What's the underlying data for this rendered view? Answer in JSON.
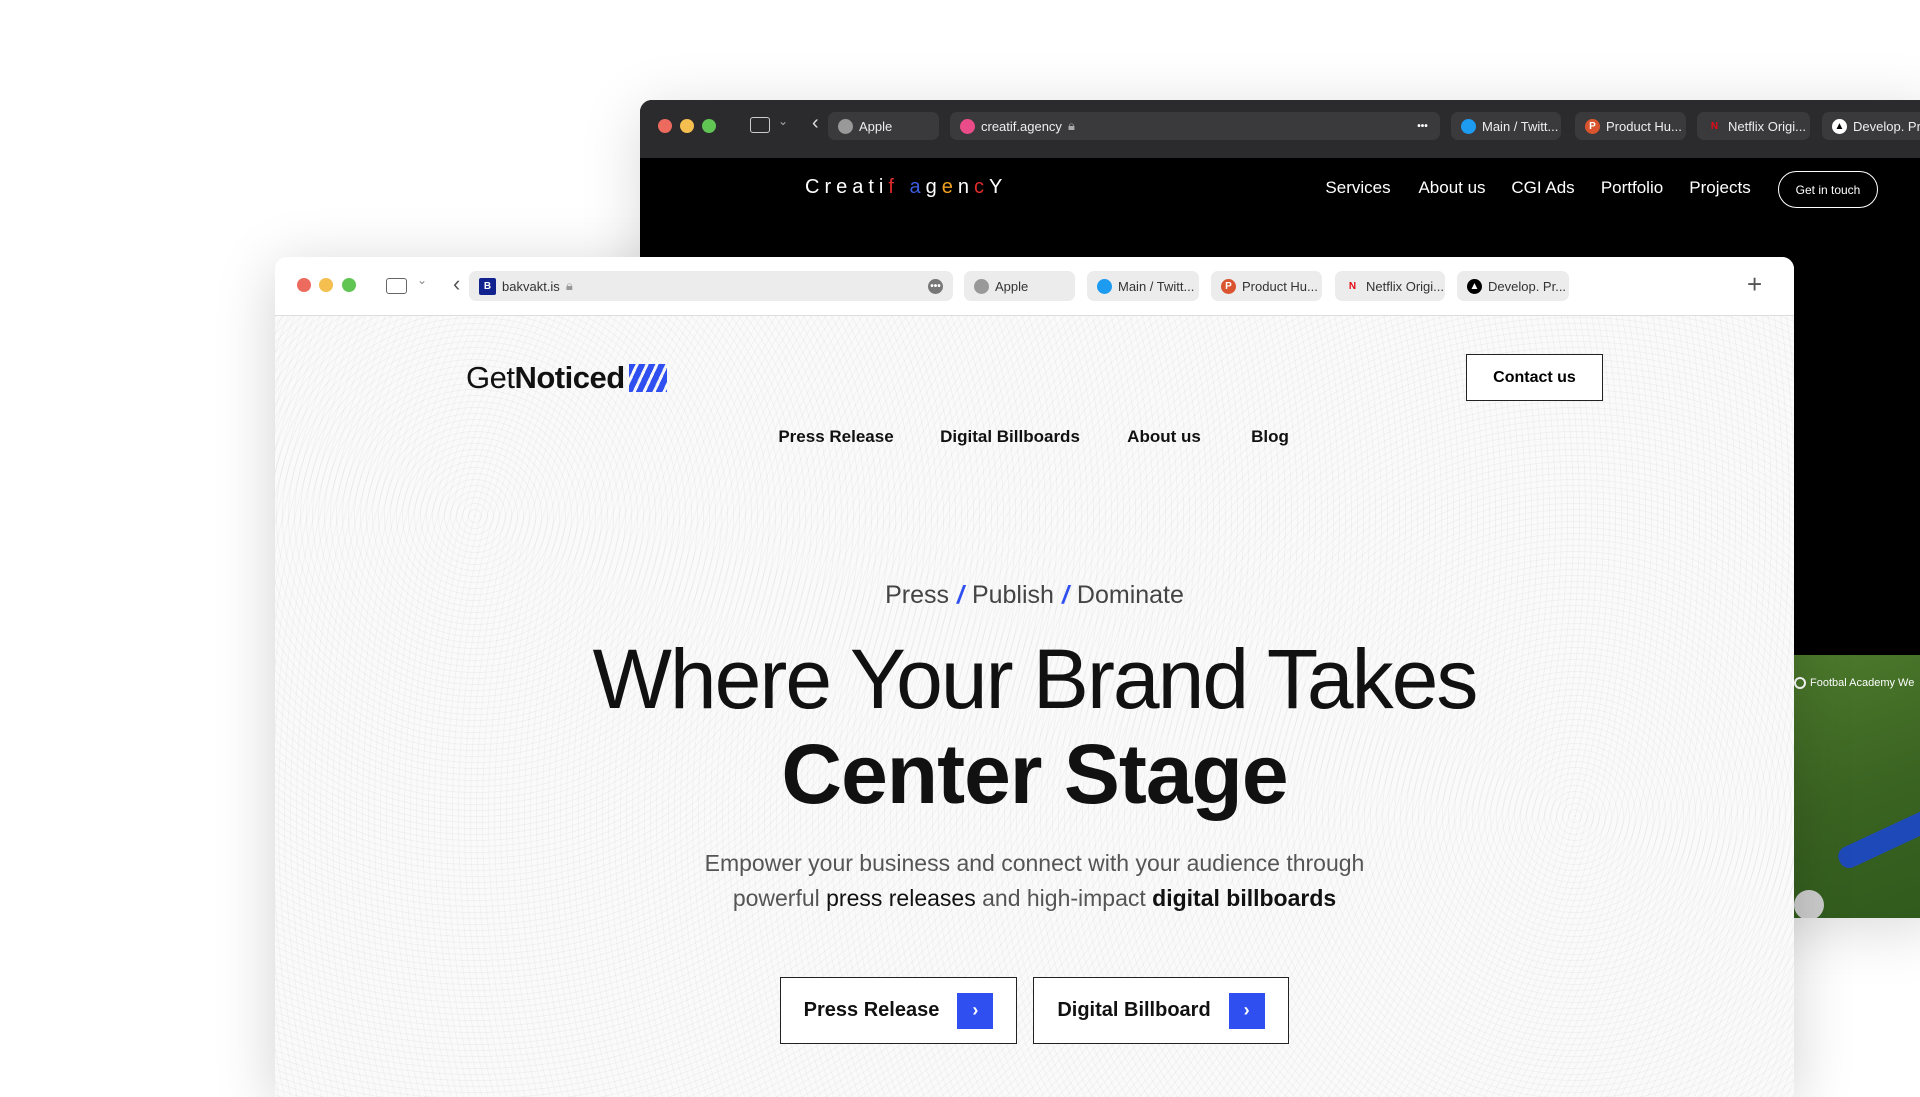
{
  "back_window": {
    "tabs": [
      {
        "label": "Apple",
        "icon": "apple-icon"
      },
      {
        "label": "Main / Twitt...",
        "icon": "twitter-icon"
      },
      {
        "label": "Product Hu...",
        "icon": "producthunt-icon"
      },
      {
        "label": "Netflix Origi...",
        "icon": "netflix-icon"
      },
      {
        "label": "Develop. Pr...",
        "icon": "develop-icon"
      }
    ],
    "address": "creatif.agency",
    "logo": "Creatif agencY",
    "nav": [
      "Services",
      "About us",
      "CGI Ads",
      "Portfolio",
      "Projects"
    ],
    "cta": "Get in touch",
    "image_caption": "Footbal Academy We"
  },
  "front_window": {
    "address": "bakvakt.is",
    "tabs": [
      {
        "label": "Apple",
        "icon": "apple-icon"
      },
      {
        "label": "Main / Twitt...",
        "icon": "twitter-icon"
      },
      {
        "label": "Product Hu...",
        "icon": "producthunt-icon"
      },
      {
        "label": "Netflix Origi...",
        "icon": "netflix-icon"
      },
      {
        "label": "Develop. Pr...",
        "icon": "develop-icon"
      }
    ],
    "logo_light": "Get",
    "logo_bold": "Noticed",
    "nav": [
      "Press Release",
      "Digital Billboards",
      "About us",
      "Blog"
    ],
    "contact": "Contact us",
    "tagline": [
      "Press",
      "Publish",
      "Dominate"
    ],
    "heading_line1": "Where Your Brand Takes",
    "heading_line2": "Center Stage",
    "sub1": "Empower your business and connect with your audience through",
    "sub2a": "powerful ",
    "sub2b": "press releases",
    "sub2c": " and high-impact ",
    "sub2d": "digital billboards",
    "buttons": [
      "Press Release",
      "Digital Billboard"
    ]
  },
  "colors": {
    "accent": "#2f4ff0",
    "close": "#ed6a5e",
    "min": "#f5bf4f",
    "max": "#61c554"
  }
}
